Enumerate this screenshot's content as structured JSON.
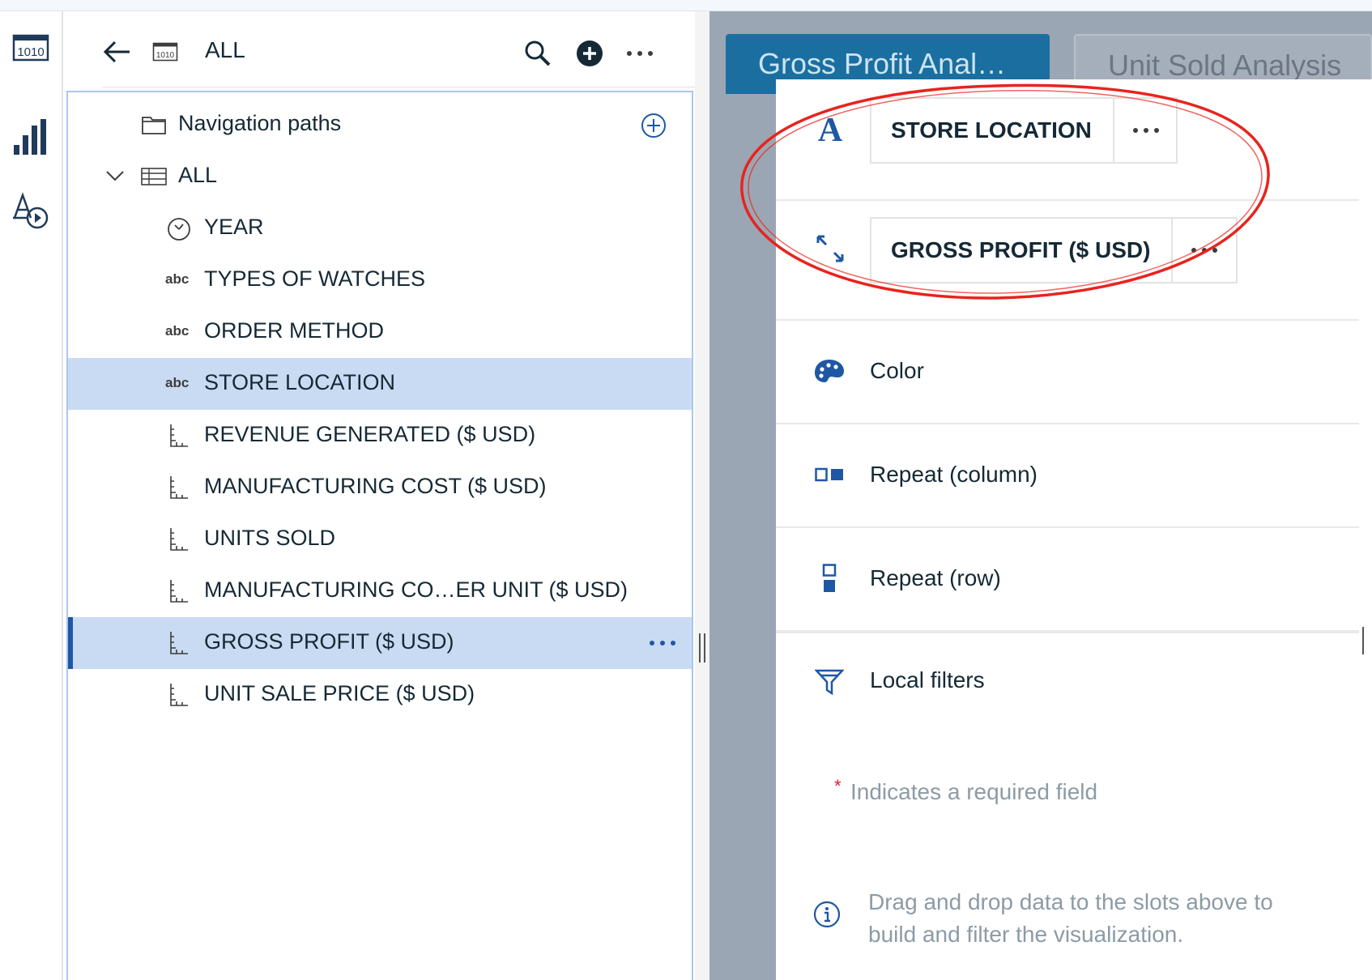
{
  "rail": {
    "items": [
      {
        "name": "data-source-icon",
        "glyph": "1010"
      },
      {
        "name": "visualizations-icon"
      },
      {
        "name": "properties-icon"
      }
    ]
  },
  "data_panel": {
    "header": {
      "title": "ALL",
      "source_icon_text": "1010"
    },
    "tree": [
      {
        "label": "Navigation paths",
        "icon": "folder-icon",
        "kind": "folder"
      },
      {
        "label": "ALL",
        "icon": "table-icon",
        "kind": "table",
        "expanded": true
      },
      {
        "label": "YEAR",
        "icon": "clock-icon",
        "kind": "time"
      },
      {
        "label": "TYPES OF WATCHES",
        "icon": "abc",
        "kind": "text"
      },
      {
        "label": "ORDER METHOD",
        "icon": "abc",
        "kind": "text"
      },
      {
        "label": "STORE LOCATION",
        "icon": "abc",
        "kind": "text",
        "selected": true
      },
      {
        "label": "REVENUE GENERATED ($ USD)",
        "icon": "measure-icon",
        "kind": "measure"
      },
      {
        "label": "MANUFACTURING COST ($ USD)",
        "icon": "measure-icon",
        "kind": "measure"
      },
      {
        "label": "UNITS SOLD",
        "icon": "measure-icon",
        "kind": "measure"
      },
      {
        "label": "MANUFACTURING CO…ER UNIT ($ USD)",
        "icon": "measure-icon",
        "kind": "measure"
      },
      {
        "label": "GROSS PROFIT ($ USD)",
        "icon": "measure-icon",
        "kind": "measure",
        "selected": true,
        "active": true
      },
      {
        "label": "UNIT SALE PRICE ($ USD)",
        "icon": "measure-icon",
        "kind": "measure"
      }
    ],
    "abc_text": "abc",
    "row_more": "•••"
  },
  "canvas": {
    "tabs": [
      {
        "label": "Gross Profit Anal…",
        "active": true
      },
      {
        "label": "Unit Sold Analysis",
        "active": false
      }
    ]
  },
  "fields": {
    "slots": [
      {
        "icon": "text-a-icon",
        "chip": "STORE LOCATION"
      },
      {
        "icon": "expand-arrows-icon",
        "chip": "GROSS PROFIT ($ USD)"
      },
      {
        "icon": "palette-icon",
        "label": "Color"
      },
      {
        "icon": "repeat-column-icon",
        "label": "Repeat (column)"
      },
      {
        "icon": "repeat-row-icon",
        "label": "Repeat (row)"
      },
      {
        "icon": "filter-icon",
        "label": "Local filters"
      }
    ],
    "chip_more": "•••",
    "required_star": "*",
    "required_note": "Indicates a required field",
    "hint": "Drag and drop data to the slots above to build and filter the visualization."
  },
  "colors": {
    "accent": "#1f57a4",
    "selection": "#c9dbf3",
    "tab_active": "#1a6fa0",
    "annotation": "#e8231d",
    "canvas_bg": "#9ba6b4"
  }
}
